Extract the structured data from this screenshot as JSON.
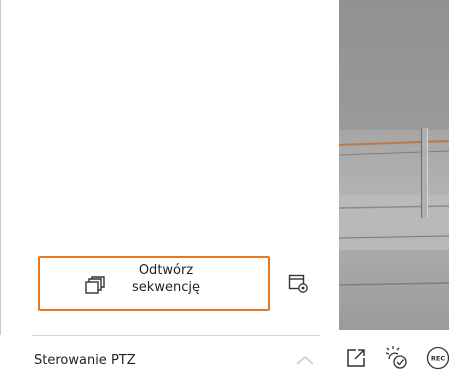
{
  "sequence_panel": {
    "play_sequence_label": "Odtwórz\nsekwencję"
  },
  "ptz": {
    "label": "Sterowanie PTZ"
  },
  "toolbar": {
    "icons": [
      "external-link-icon",
      "brightness-check-icon",
      "record-icon"
    ],
    "record_text": "REC"
  },
  "colors": {
    "accent": "#e87722",
    "text": "#222222",
    "divider": "#d6d6d6"
  }
}
